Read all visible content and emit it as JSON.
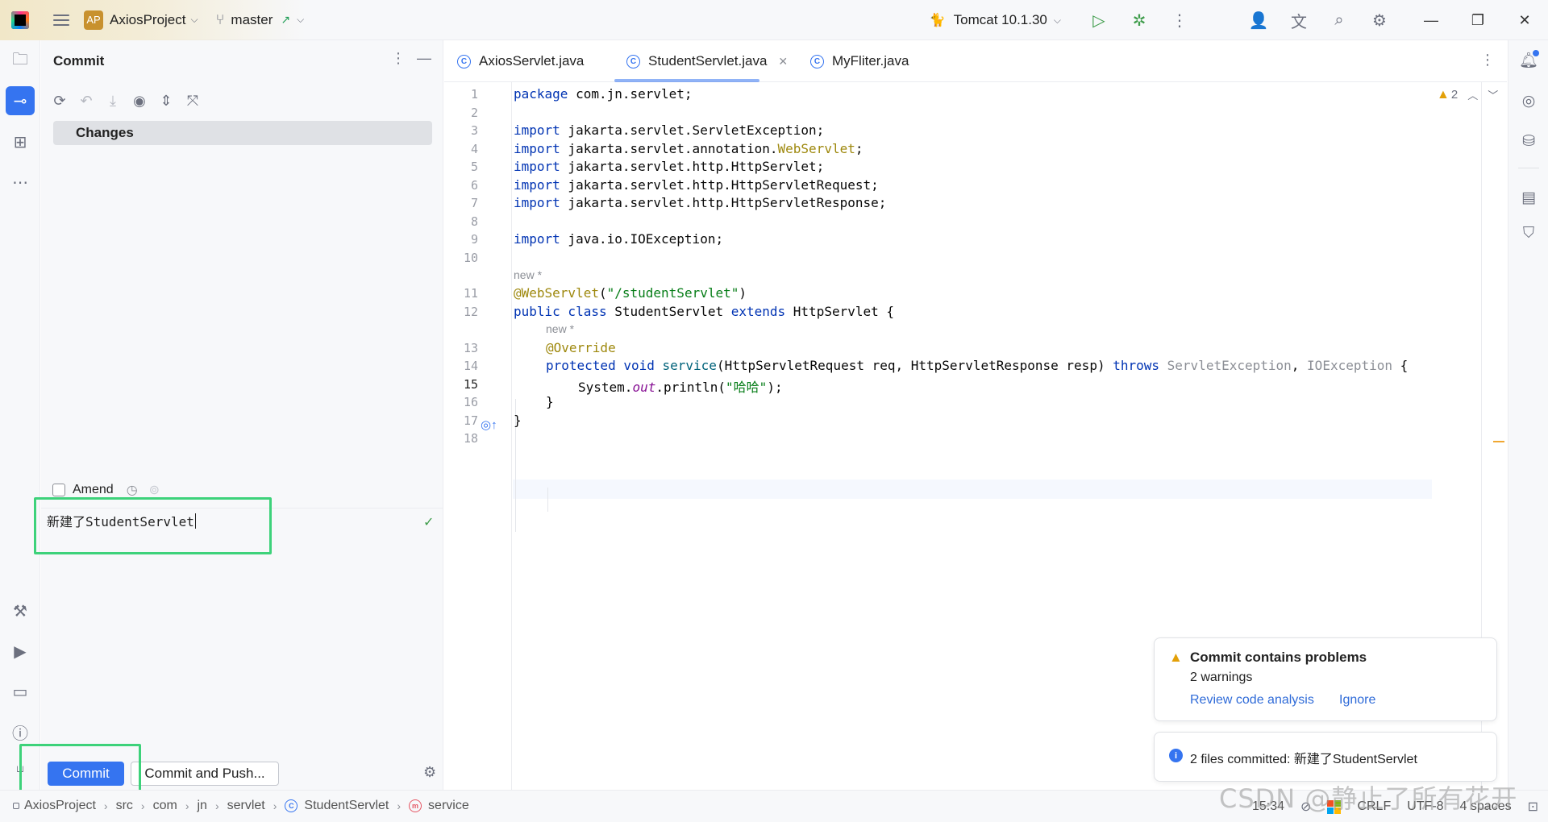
{
  "titlebar": {
    "project_badge": "AP",
    "project_name": "AxiosProject",
    "branch": "master",
    "run_config": "Tomcat 10.1.30"
  },
  "commit_panel": {
    "title": "Commit",
    "changes_label": "Changes",
    "amend_label": "Amend",
    "commit_message": "新建了StudentServlet",
    "commit_button": "Commit",
    "commit_push_button": "Commit and Push..."
  },
  "editor": {
    "tabs": [
      {
        "label": "AxiosServlet.java",
        "active": false
      },
      {
        "label": "StudentServlet.java",
        "active": true
      },
      {
        "label": "MyFliter.java",
        "active": false
      }
    ],
    "warning_count": "2",
    "line_numbers": [
      "1",
      "2",
      "3",
      "4",
      "5",
      "6",
      "7",
      "8",
      "9",
      "10",
      "11",
      "12",
      "13",
      "14",
      "15",
      "16",
      "17",
      "18"
    ],
    "current_line": "15",
    "code_hints": [
      "new *",
      "new *"
    ],
    "code": {
      "l1_kw": "package",
      "l1_rest": " com.jn.servlet;",
      "import_kw": "import",
      "l3": " jakarta.servlet.ServletException;",
      "l4a": " jakarta.servlet.annotation.",
      "l4b": "WebServlet",
      "l4c": ";",
      "l5": " jakarta.servlet.http.HttpServlet;",
      "l6": " jakarta.servlet.http.HttpServletRequest;",
      "l7": " jakarta.servlet.http.HttpServletResponse;",
      "l9": " java.io.IOException;",
      "l11_ann": "@WebServlet",
      "l11_open": "(",
      "l11_str": "\"/studentServlet\"",
      "l11_close": ")",
      "l12_kw1": "public class",
      "l12_name": " StudentServlet ",
      "l12_kw2": "extends",
      "l12_rest": " HttpServlet {",
      "l13_ann": "@Override",
      "l14_kw": "protected void",
      "l14_mth": "service",
      "l14_params": "(HttpServletRequest req, HttpServletResponse resp) ",
      "l14_throws": "throws",
      "l14_exc1": " ServletException",
      "l14_comma": ", ",
      "l14_exc2": "IOException",
      "l14_brace": " {",
      "l15_a": "System.",
      "l15_fld": "out",
      "l15_b": ".println(",
      "l15_str": "\"哈哈\"",
      "l15_c": ");",
      "l16": "}",
      "l17": "}"
    }
  },
  "notifications": {
    "problems_title": "Commit contains problems",
    "problems_sub": "2 warnings",
    "review_link": "Review code analysis",
    "ignore_link": "Ignore",
    "committed_text": "2 files committed: 新建了StudentServlet"
  },
  "statusbar": {
    "breadcrumbs": [
      "AxiosProject",
      "src",
      "com",
      "jn",
      "servlet",
      "StudentServlet",
      "service"
    ],
    "time": "15:34",
    "line_sep": "CRLF",
    "encoding": "UTF-8",
    "indent": "4 spaces"
  },
  "watermark": "CSDN @静止了所有花开"
}
